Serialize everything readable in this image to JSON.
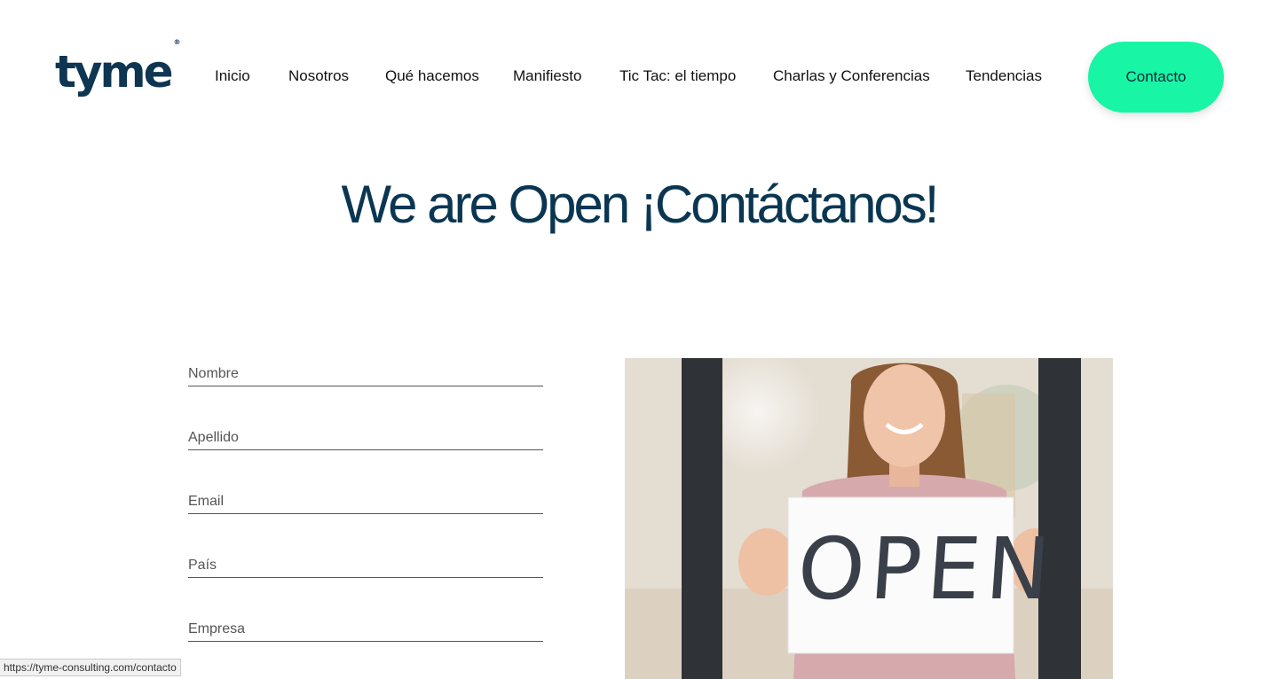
{
  "brand": {
    "logo_text": "tyme",
    "registered_mark": "®"
  },
  "nav": {
    "items": [
      "Inicio",
      "Nosotros",
      "Qué hacemos",
      "Manifiesto",
      "Tic Tac: el tiempo",
      "Charlas y Conferencias",
      "Tendencias"
    ],
    "contact_label": "Contacto"
  },
  "page": {
    "title": "We are Open ¡Contáctanos!"
  },
  "form": {
    "fields": [
      {
        "placeholder": "Nombre"
      },
      {
        "placeholder": "Apellido"
      },
      {
        "placeholder": "Email"
      },
      {
        "placeholder": "País"
      },
      {
        "placeholder": "Empresa"
      }
    ]
  },
  "photo": {
    "sign_text": "OPEN"
  },
  "status_bar": {
    "url": "https://tyme-consulting.com/contacto"
  },
  "colors": {
    "accent": "#18f5a5",
    "brand_dark": "#0a3652"
  }
}
